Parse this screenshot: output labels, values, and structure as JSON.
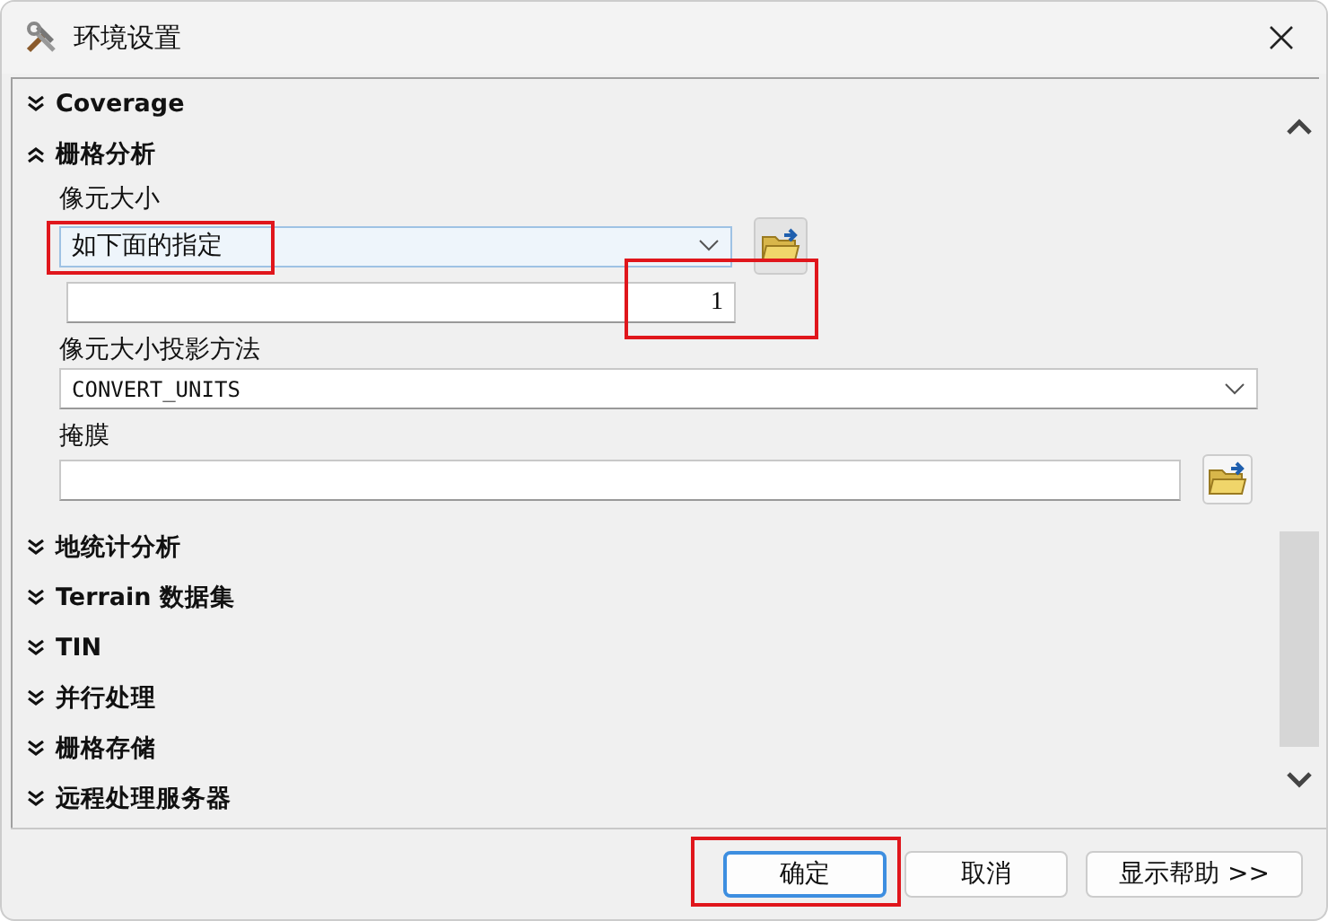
{
  "window": {
    "title": "环境设置"
  },
  "sections": [
    {
      "title": "Coverage",
      "expanded": false
    },
    {
      "title": "栅格分析",
      "expanded": true,
      "fields": [
        {
          "kind": "select-browse",
          "label": "像元大小",
          "value": "如下面的指定",
          "highlighted": true
        },
        {
          "kind": "number",
          "value": "1",
          "highlighted": true
        },
        {
          "kind": "select",
          "label": "像元大小投影方法",
          "value": "CONVERT_UNITS"
        },
        {
          "kind": "browse",
          "label": "掩膜"
        }
      ]
    },
    {
      "title": "地统计分析",
      "expanded": false
    },
    {
      "title": "Terrain 数据集",
      "expanded": false
    },
    {
      "title": "TIN",
      "expanded": false
    },
    {
      "title": "并行处理",
      "expanded": false
    },
    {
      "title": "栅格存储",
      "expanded": false
    },
    {
      "title": "远程处理服务器",
      "expanded": false
    }
  ],
  "buttons": [
    {
      "label": "确定",
      "highlighted": true
    },
    {
      "label": "取消",
      "highlighted": false
    },
    {
      "label": "显示帮助 >>",
      "highlighted": false
    }
  ]
}
